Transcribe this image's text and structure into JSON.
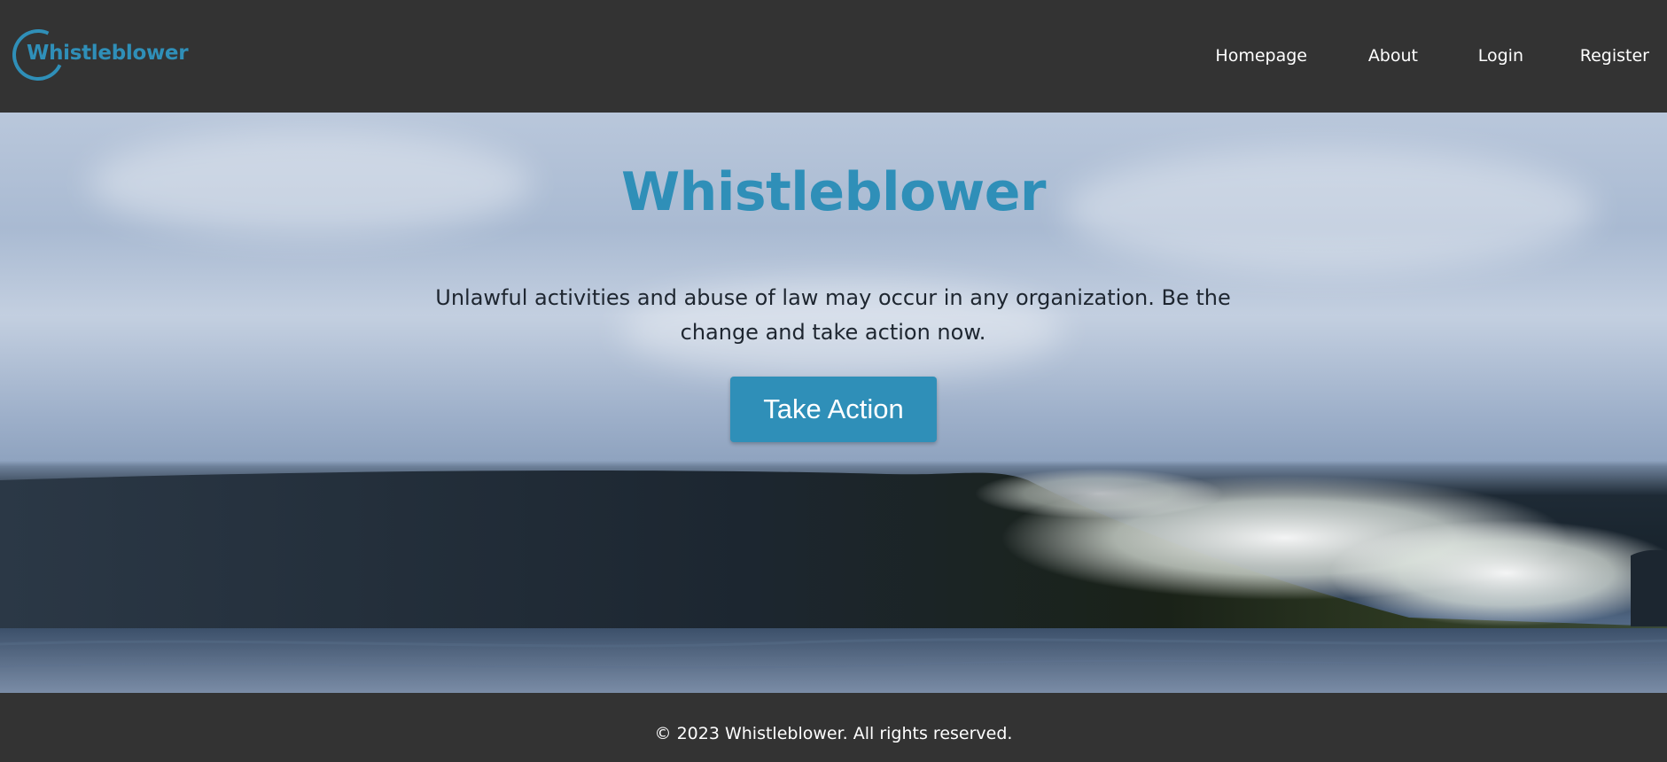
{
  "header": {
    "logo_text": "Whistleblower",
    "nav": [
      {
        "label": "Homepage"
      },
      {
        "label": "About"
      },
      {
        "label": "Login"
      },
      {
        "label": "Register"
      }
    ]
  },
  "hero": {
    "title": "Whistleblower",
    "subtitle": "Unlawful activities and abuse of law may occur in any organization. Be the change and take action now.",
    "cta_label": "Take Action"
  },
  "footer": {
    "copyright": "© 2023 Whistleblower. All rights reserved."
  },
  "colors": {
    "brand": "#2f8fb8",
    "header_bg": "#333333",
    "text_light": "#ffffff"
  }
}
